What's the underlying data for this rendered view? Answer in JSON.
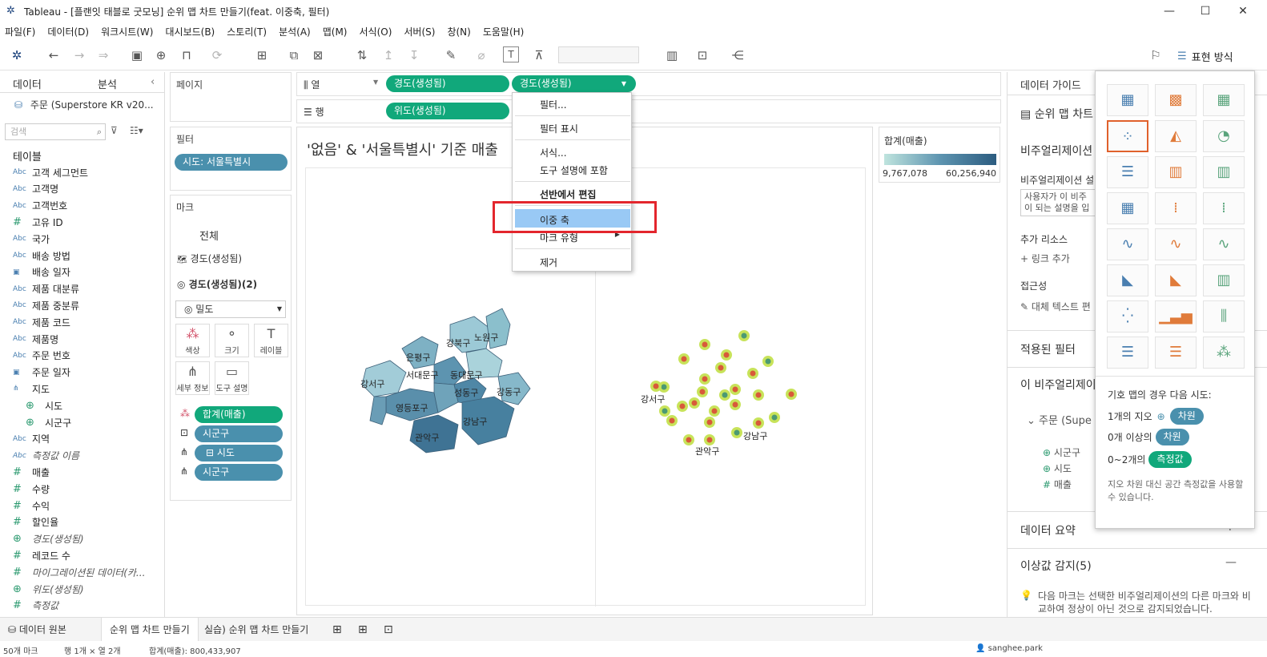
{
  "window": {
    "title": "Tableau - [플랜잇 태블로 굿모닝] 순위 맵 차트 만들기(feat. 이중축, 필터)"
  },
  "menu": [
    "파일(F)",
    "데이터(D)",
    "워크시트(W)",
    "대시보드(B)",
    "스토리(T)",
    "분석(A)",
    "맵(M)",
    "서식(O)",
    "서버(S)",
    "창(N)",
    "도움말(H)"
  ],
  "toolbar": {
    "show_me_label": "표현 방식"
  },
  "data_pane": {
    "tab_data": "데이터",
    "tab_analysis": "분석",
    "datasource": "주문 (Superstore KR v20...",
    "search_placeholder": "검색",
    "tables_label": "테이블",
    "fields": [
      {
        "type": "Abc",
        "name": "고객 세그먼트"
      },
      {
        "type": "Abc",
        "name": "고객명"
      },
      {
        "type": "Abc",
        "name": "고객번호"
      },
      {
        "type": "#",
        "name": "고유 ID"
      },
      {
        "type": "Abc",
        "name": "국가"
      },
      {
        "type": "Abc",
        "name": "배송 방법"
      },
      {
        "type": "date",
        "name": "배송 일자"
      },
      {
        "type": "Abc",
        "name": "제품 대분류"
      },
      {
        "type": "Abc",
        "name": "제품 중분류"
      },
      {
        "type": "Abc",
        "name": "제품 코드"
      },
      {
        "type": "Abc",
        "name": "제품명"
      },
      {
        "type": "Abc",
        "name": "주문 번호"
      },
      {
        "type": "date",
        "name": "주문 일자"
      },
      {
        "type": "hier",
        "name": "지도"
      },
      {
        "type": "geo",
        "name": "시도"
      },
      {
        "type": "geo",
        "name": "시군구"
      },
      {
        "type": "Abc",
        "name": "지역"
      },
      {
        "type": "Abc",
        "name": "측정값 이름"
      },
      {
        "type": "#",
        "name": "매출"
      },
      {
        "type": "#",
        "name": "수량"
      },
      {
        "type": "#",
        "name": "수익"
      },
      {
        "type": "#",
        "name": "할인율"
      },
      {
        "type": "geo",
        "name": "경도(생성됨)"
      },
      {
        "type": "#",
        "name": "레코드 수"
      },
      {
        "type": "#",
        "name": "마이그레이션된 데이터(카..."
      },
      {
        "type": "geo",
        "name": "위도(생성됨)"
      },
      {
        "type": "#",
        "name": "측정값"
      }
    ]
  },
  "cards": {
    "pages_label": "페이지",
    "filters_label": "필터",
    "filter_pill": "시도: 서울특별시",
    "marks_label": "마크",
    "marks_all": "전체",
    "marks_layer1": "경도(생성됨)",
    "marks_layer2": "경도(생성됨)(2)",
    "mark_type": "밀도",
    "btn_color": "색상",
    "btn_size": "크기",
    "btn_label": "레이블",
    "btn_detail": "세부 정보",
    "btn_tooltip": "도구 설명",
    "mark_pills": [
      "합계(매출)",
      "시군구",
      "시도",
      "시군구"
    ]
  },
  "shelves": {
    "columns_label": "열",
    "rows_label": "행",
    "col_pill1": "경도(생성됨)",
    "col_pill2": "경도(생성됨)",
    "row_pill1": "위도(생성됨)"
  },
  "viz": {
    "title": "'없음' & '서울특별시' 기준 매출",
    "legend_title": "합계(매출)",
    "legend_min": "9,767,078",
    "legend_max": "60,256,940",
    "map_labels_left": [
      "강북구",
      "노원구",
      "은평구",
      "서대문구",
      "동대문구",
      "강서구",
      "성동구",
      "강동구",
      "영등포구",
      "강남구",
      "관악구"
    ],
    "map_labels_right": [
      "강서구",
      "강남구",
      "관악구"
    ]
  },
  "context_menu": {
    "items": [
      "필터...",
      "필터 표시",
      "서식...",
      "도구 설명에 포함",
      "선반에서 편집",
      "이중 축",
      "마크 유형",
      "제거"
    ]
  },
  "right_pane": {
    "header": "데이터 가이드",
    "viz_title": "순위 맵 차트",
    "section_viz": "비주얼리제이션",
    "viz_desc_label": "비주얼리제이션 설",
    "viz_desc_text": "사용자가 이 비주 이 되는 설명을 입",
    "extra_resources": "추가 리소스",
    "add_link": "링크 추가",
    "accessibility": "접근성",
    "alt_text": "대체 텍스트 편",
    "applied_filters": "적용된 필터",
    "this_viz": "이 비주얼리제이",
    "source": "주문 (Supe",
    "src_fields": [
      "시군구",
      "시도",
      "매출"
    ],
    "data_summary": "데이터 요약",
    "outliers": "이상값 감지(5)",
    "outlier_desc": "다음 마크는 선택한 비주얼리제이션의 다른 마크와 비교하여 정상이 아닌 것으로 감지되었습니다."
  },
  "showme_panel": {
    "hint_title": "기호 맵의 경우 다음 시도:",
    "req1_pre": "1개의 지오",
    "req1_tag": "차원",
    "req2_pre": "0개 이상의",
    "req2_tag": "차원",
    "req3_pre": "0~2개의",
    "req3_tag": "측정값",
    "note": "지오 차원 대신 공간 측정값을 사용할 수 있습니다."
  },
  "bottom_tabs": {
    "datasource": "데이터 원본",
    "tab1": "순위 맵 차트 만들기",
    "tab2": "실습) 순위 맵 차트 만들기"
  },
  "status": {
    "marks": "50개 마크",
    "rows": "행 1개 × 열 2개",
    "sum": "합계(매출): 800,433,907",
    "user": "sanghee.park"
  },
  "colors": {
    "accent_green": "#11a87b",
    "accent_blue": "#4a90ad",
    "highlight": "#99c9f5",
    "red_box": "#e3262d"
  }
}
